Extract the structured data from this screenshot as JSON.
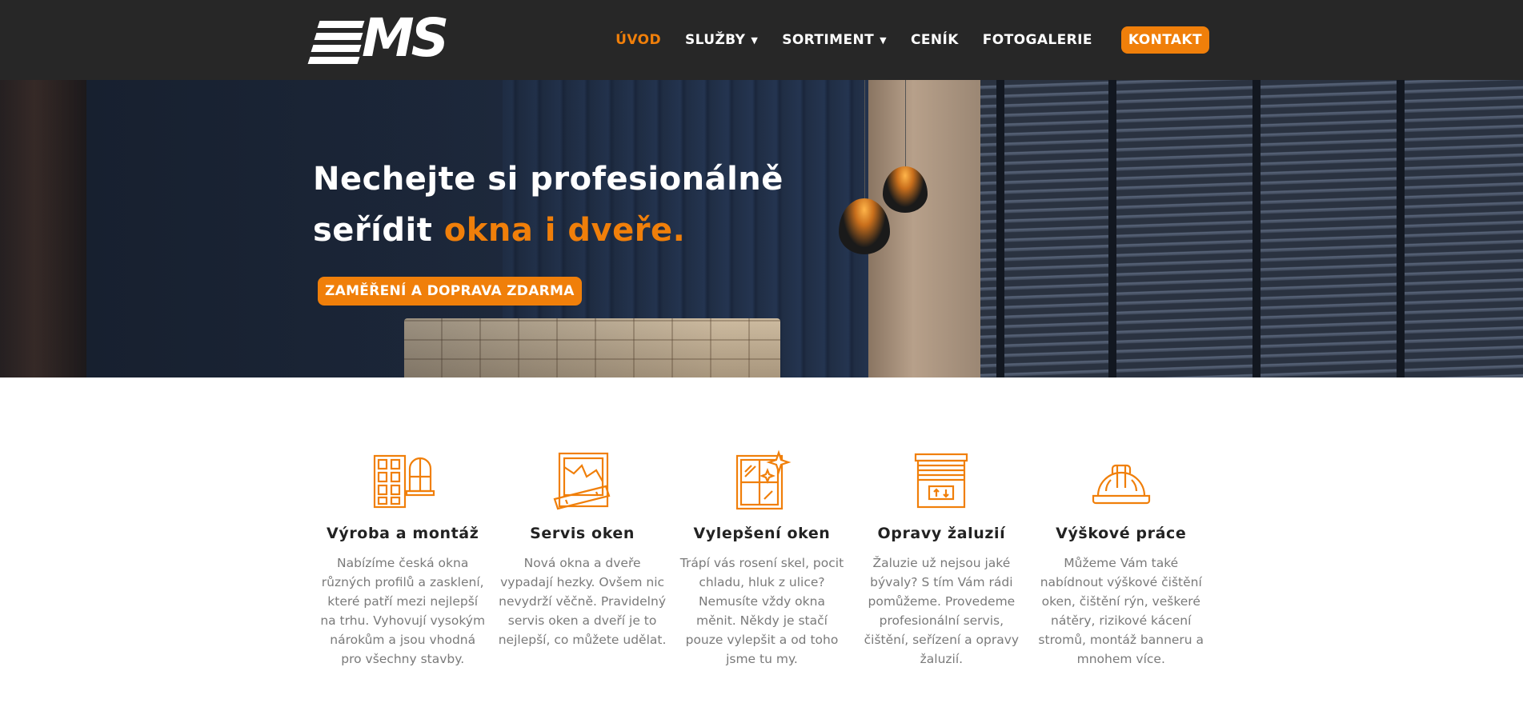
{
  "header": {
    "logo_text": "MS",
    "nav": [
      {
        "label": "ÚVOD",
        "active": true,
        "dropdown": false
      },
      {
        "label": "SLUŽBY",
        "active": false,
        "dropdown": true
      },
      {
        "label": "SORTIMENT",
        "active": false,
        "dropdown": true
      },
      {
        "label": "CENÍK",
        "active": false,
        "dropdown": false
      },
      {
        "label": "FOTOGALERIE",
        "active": false,
        "dropdown": false
      }
    ],
    "cta_label": "KONTAKT"
  },
  "hero": {
    "title_line1": "Nechejte si profesionálně",
    "title_line2_prefix": "seřídit ",
    "title_line2_accent": "okna i dveře.",
    "cta_label": "ZAMĚŘENÍ A DOPRAVA ZDARMA"
  },
  "services": [
    {
      "icon": "window-door-icon",
      "title": "Výroba a montáž",
      "desc": "Nabízíme česká okna různých profilů a zasklení, které patří mezi nejlepší na trhu. Vyhovují vysokým nárokům a jsou vhodná pro všechny stavby."
    },
    {
      "icon": "broken-window-icon",
      "title": "Servis oken",
      "desc": "Nová okna a dveře vypadají hezky. Ovšem nic nevydrží věčně. Pravidelný servis oken a dveří je to nejlepší, co můžete udělat."
    },
    {
      "icon": "sparkling-window-icon",
      "title": "Vylepšení oken",
      "desc": "Trápí vás rosení skel, pocit chladu, hluk z ulice? Nemusíte vždy okna měnit. Někdy je stačí pouze vylepšit a od toho jsme tu my."
    },
    {
      "icon": "blinds-icon",
      "title": "Opravy žaluzií",
      "desc": "Žaluzie už nejsou jaké bývaly? S tím Vám rádi pomůžeme. Provedeme profesionální servis, čištění, seřízení a opravy žaluzií."
    },
    {
      "icon": "hard-hat-icon",
      "title": "Výškové práce",
      "desc": "Můžeme Vám také nabídnout výškové čištění oken, čištění rýn, veškeré nátěry, rizikové kácení stromů, montáž banneru a mnohem více."
    }
  ],
  "colors": {
    "accent": "#f07f0a",
    "header_bg": "#272727",
    "text_dark": "#222222",
    "text_muted": "#7a7a7a"
  }
}
